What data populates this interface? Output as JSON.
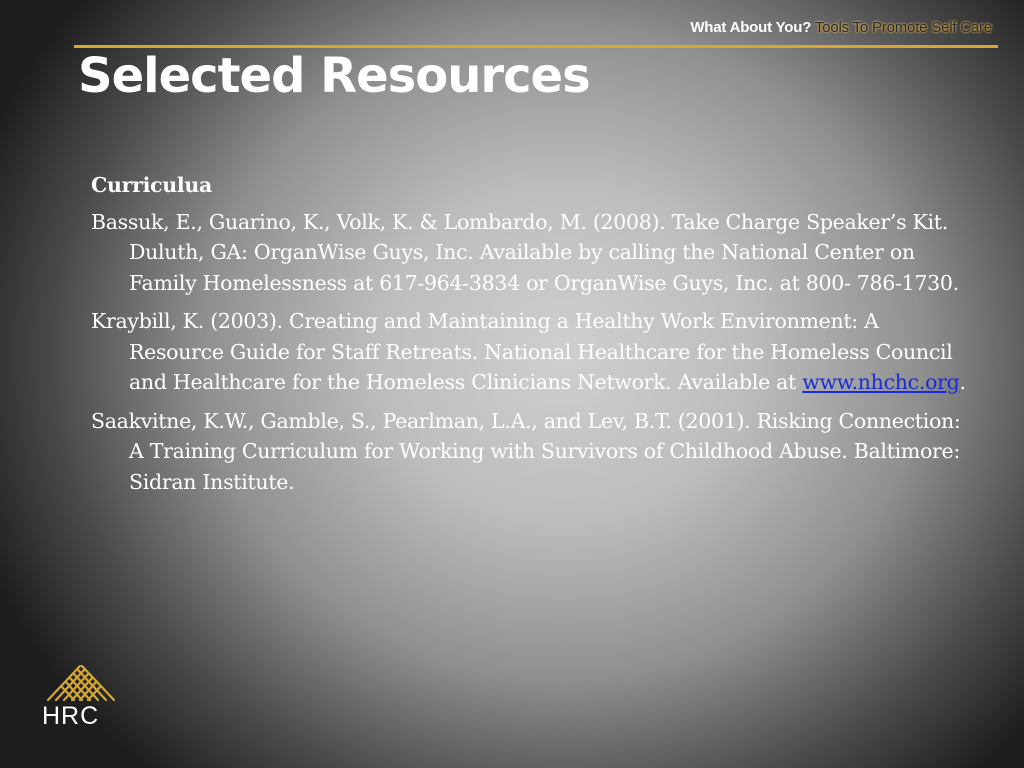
{
  "header": {
    "tag_strong": "What About You?",
    "tag_soft": "Tools To Promote Self Care"
  },
  "slide": {
    "title": "Selected Resources",
    "section_heading": "Curriculua",
    "entries": [
      {
        "text": "Bassuk, E., Guarino, K., Volk, K. & Lombardo, M.  (2008). Take Charge Speaker’s Kit.  Duluth, GA: OrganWise Guys, Inc.  Available by calling the National Center on Family Homelessness at 617-964-3834 or OrganWise Guys, Inc. at 800- 786-1730."
      },
      {
        "text": "Kraybill, K. (2003).  Creating and Maintaining a Healthy Work Environment: A Resource Guide for Staff Retreats. National Healthcare for the Homeless Council and Healthcare for the Homeless Clinicians Network.  Available at ",
        "link": "www.nhchc.org",
        "after": "."
      },
      {
        "text": "Saakvitne, K.W., Gamble, S., Pearlman, L.A., and Lev, B.T. (2001). Risking Connection: A Training Curriculum for Working with Survivors of Childhood Abuse. Baltimore: Sidran Institute."
      }
    ]
  },
  "logo": {
    "text": "HRC",
    "icon": "woven-lattice-icon",
    "color": "#d6a733"
  },
  "colors": {
    "accent": "#d6a733",
    "text": "#ffffff",
    "link": "#1a2cd6"
  }
}
